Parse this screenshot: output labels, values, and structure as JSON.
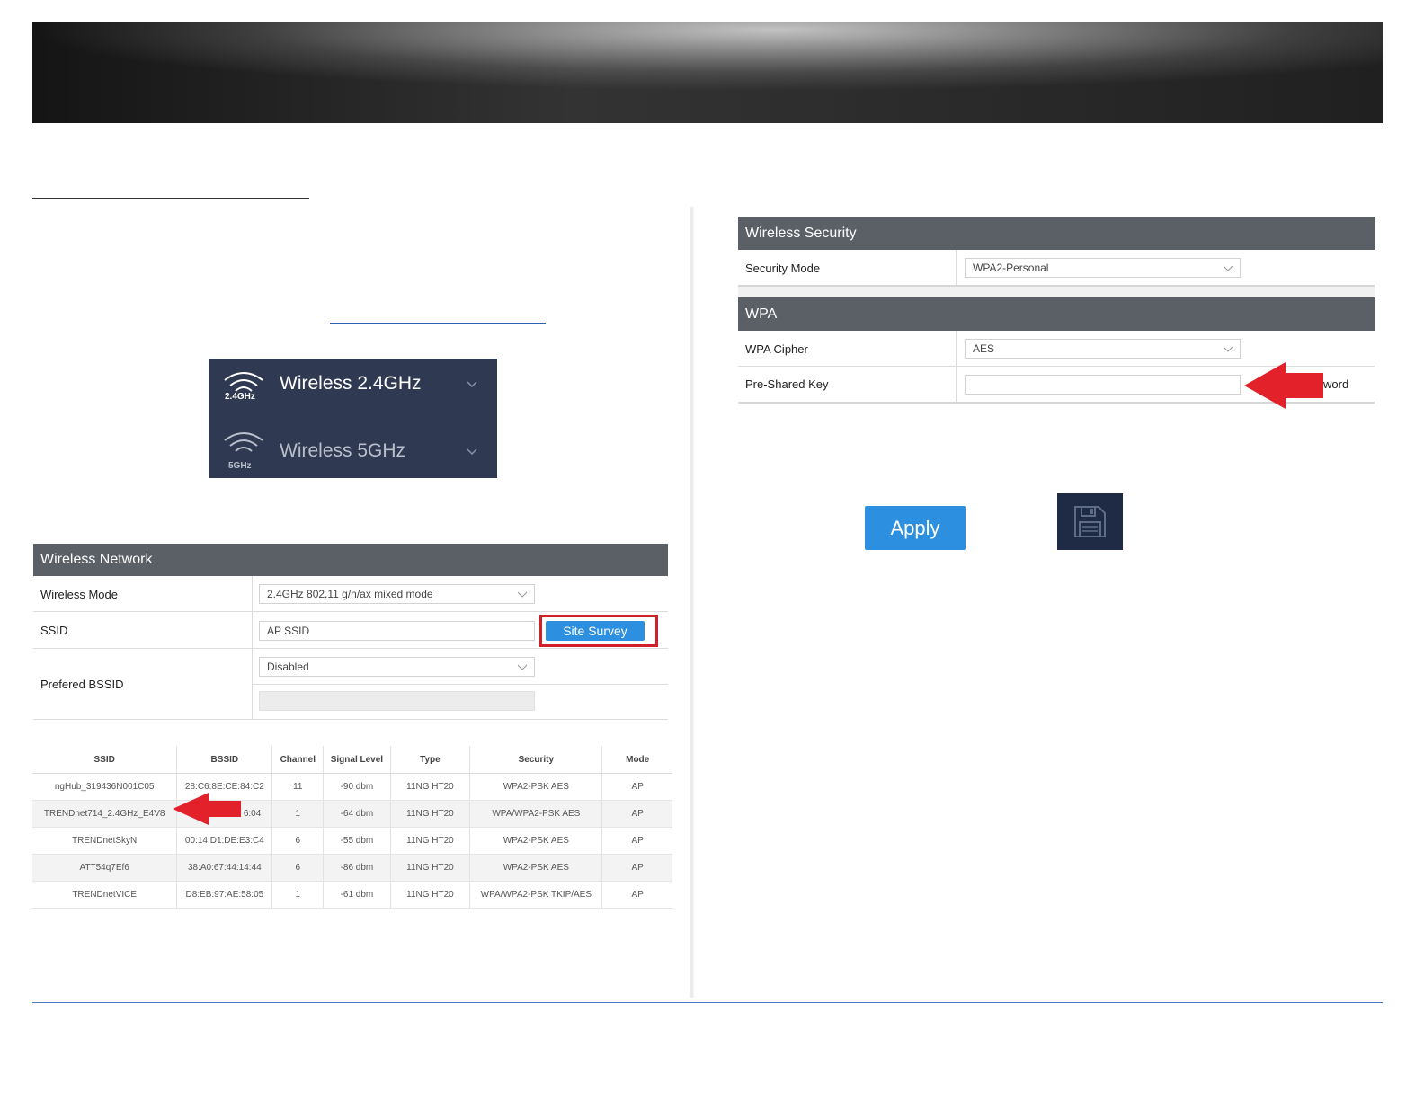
{
  "band_menu": {
    "items": [
      {
        "label": "Wireless 2.4GHz",
        "badge": "2.4GHz"
      },
      {
        "label": "Wireless 5GHz",
        "badge": "5GHz"
      }
    ]
  },
  "wireless_network": {
    "title": "Wireless Network",
    "wireless_mode_label": "Wireless Mode",
    "wireless_mode_value": "2.4GHz 802.11 g/n/ax mixed mode",
    "ssid_label": "SSID",
    "ssid_placeholder": "AP SSID",
    "site_survey_label": "Site Survey",
    "bssid_label": "Prefered BSSID",
    "bssid_value": "Disabled"
  },
  "survey": {
    "columns": [
      "SSID",
      "BSSID",
      "Channel",
      "Signal Level",
      "Type",
      "Security",
      "Mode"
    ],
    "rows": [
      [
        "ngHub_319436N001C05",
        "28:C6:8E:CE:84:C2",
        "11",
        "-90 dbm",
        "11NG HT20",
        "WPA2-PSK AES",
        "AP"
      ],
      [
        "TRENDnet714_2.4GHz_E4V8",
        "6:04",
        "1",
        "-64 dbm",
        "11NG HT20",
        "WPA/WPA2-PSK AES",
        "AP"
      ],
      [
        "TRENDnetSkyN",
        "00:14:D1:DE:E3:C4",
        "6",
        "-55 dbm",
        "11NG HT20",
        "WPA2-PSK AES",
        "AP"
      ],
      [
        "ATT54q7Ef6",
        "38:A0:67:44:14:44",
        "6",
        "-86 dbm",
        "11NG HT20",
        "WPA2-PSK AES",
        "AP"
      ],
      [
        "TRENDnetVICE",
        "D8:EB:97:AE:58:05",
        "1",
        "-61 dbm",
        "11NG HT20",
        "WPA/WPA2-PSK TKIP/AES",
        "AP"
      ]
    ]
  },
  "wireless_security": {
    "title": "Wireless Security",
    "security_mode_label": "Security Mode",
    "security_mode_value": "WPA2-Personal"
  },
  "wpa": {
    "title": "WPA",
    "cipher_label": "WPA Cipher",
    "cipher_value": "AES",
    "psk_label": "Pre-Shared Key",
    "psk_suffix": "word"
  },
  "actions": {
    "apply_label": "Apply",
    "save_icon": "floppy-disk-icon"
  },
  "colors": {
    "header_gray": "#5b5f66",
    "button_blue": "#2d8fe0",
    "menu_navy": "#2f3a52",
    "highlight_red": "#d0202a"
  }
}
